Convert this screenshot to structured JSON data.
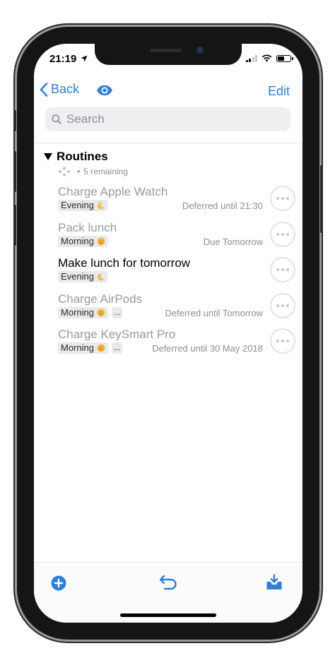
{
  "status_bar": {
    "time": "21:19",
    "battery_level": 0.55
  },
  "nav": {
    "back_label": "Back",
    "edit_label": "Edit"
  },
  "search": {
    "placeholder": "Search"
  },
  "section": {
    "title": "Routines",
    "remaining": "5 remaining"
  },
  "tasks": [
    {
      "title": "Charge Apple Watch",
      "tag": "Evening",
      "tag_icon": "moon-icon",
      "extra": false,
      "due": "Deferred until 21:30",
      "dimmed": true
    },
    {
      "title": "Pack lunch",
      "tag": "Morning",
      "tag_icon": "sun-icon",
      "extra": false,
      "due": "Due Tomorrow",
      "dimmed": true
    },
    {
      "title": "Make lunch for tomorrow",
      "tag": "Evening",
      "tag_icon": "moon-icon",
      "extra": false,
      "due": "",
      "dimmed": false
    },
    {
      "title": "Charge AirPods",
      "tag": "Morning",
      "tag_icon": "sun-icon",
      "extra": true,
      "due": "Deferred until Tomorrow",
      "dimmed": true
    },
    {
      "title": "Charge KeySmart Pro",
      "tag": "Morning",
      "tag_icon": "sun-icon",
      "extra": true,
      "due": "Deferred until 30 May 2018",
      "dimmed": true
    }
  ],
  "tag_extra_label": "...",
  "colors": {
    "accent": "#2f7fd4",
    "dimmed_text": "#9a9a9e",
    "moon": "#f2c14e",
    "sun": "#f5b73b"
  },
  "toolbar": {
    "icons": [
      "add-circle-icon",
      "undo-icon",
      "inbox-download-icon"
    ]
  }
}
